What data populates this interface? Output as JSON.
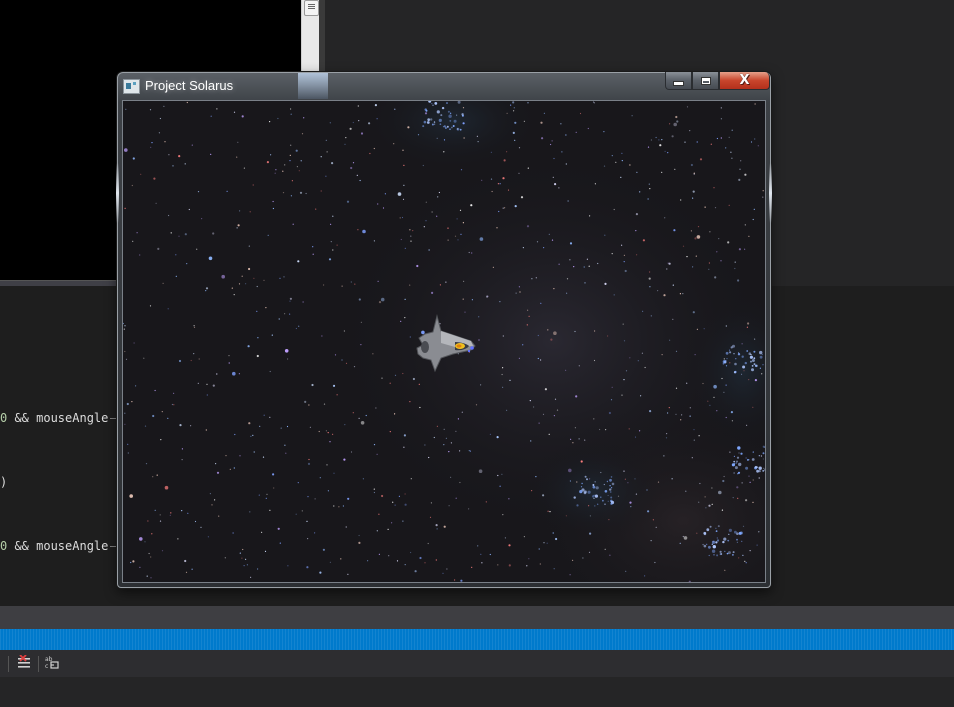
{
  "console": {},
  "editor": {
    "lines": [
      {
        "prefix_num": "0",
        "text": " && mouseAngle"
      },
      {
        "text": ")"
      },
      {
        "prefix_num": "0",
        "text": " && mouseAngle"
      }
    ]
  },
  "status_bar": {
    "color": "#007acc"
  },
  "toolbar": {
    "icons": [
      "clear-all-list-icon",
      "word-wrap-icon"
    ]
  },
  "game_window": {
    "title": "Project Solarus",
    "app_icon": "app-window-icon",
    "controls": {
      "minimize_icon": "minimize-icon",
      "maximize_icon": "maximize-icon",
      "close_icon": "close-icon",
      "close_glyph": "X"
    },
    "scene": {
      "background": "starfield",
      "player": "spaceship-sprite"
    }
  },
  "colors": {
    "ide_background": "#252526",
    "editor_background": "#1e1e1e",
    "accent": "#007acc",
    "close_button": "#c8452c"
  }
}
